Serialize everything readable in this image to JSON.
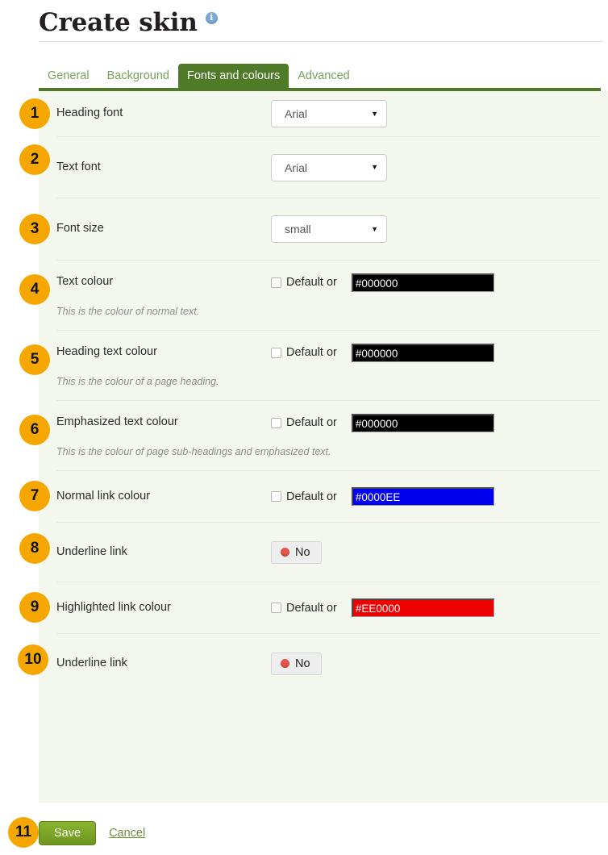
{
  "header": {
    "title": "Create skin",
    "info_icon": "info-icon"
  },
  "tabs": [
    {
      "label": "General",
      "active": false
    },
    {
      "label": "Background",
      "active": false
    },
    {
      "label": "Fonts and colours",
      "active": true
    },
    {
      "label": "Advanced",
      "active": false
    }
  ],
  "colors": {
    "accent_green": "#4f7a28",
    "tab_text_green": "#7ba05b",
    "badge_orange": "#f5a700",
    "panel_bg": "#f4f7ee",
    "save_green": "#7ba428",
    "info_blue": "#7da7d9",
    "toggle_dot_red": "#e8544b"
  },
  "rows": [
    {
      "badge": "1",
      "label": "Heading font",
      "control": "select",
      "value": "Arial",
      "help": ""
    },
    {
      "badge": "2",
      "label": "Text font",
      "control": "select",
      "value": "Arial",
      "help": ""
    },
    {
      "badge": "3",
      "label": "Font size",
      "control": "select",
      "value": "small",
      "help": ""
    },
    {
      "badge": "4",
      "label": "Text colour",
      "control": "colour",
      "checkbox_label": "Default or",
      "checked": false,
      "value": "#000000",
      "swatch": "#000000",
      "help": "This is the colour of normal text."
    },
    {
      "badge": "5",
      "label": "Heading text colour",
      "control": "colour",
      "checkbox_label": "Default or",
      "checked": false,
      "value": "#000000",
      "swatch": "#000000",
      "help": "This is the colour of a page heading."
    },
    {
      "badge": "6",
      "label": "Emphasized text colour",
      "control": "colour",
      "checkbox_label": "Default or",
      "checked": false,
      "value": "#000000",
      "swatch": "#000000",
      "help": "This is the colour of page sub-headings and emphasized text."
    },
    {
      "badge": "7",
      "label": "Normal link colour",
      "control": "colour",
      "checkbox_label": "Default or",
      "checked": false,
      "value": "#0000EE",
      "swatch": "#0000EE",
      "help": ""
    },
    {
      "badge": "8",
      "label": "Underline link",
      "control": "toggle",
      "value": "No",
      "help": ""
    },
    {
      "badge": "9",
      "label": "Highlighted link colour",
      "control": "colour",
      "checkbox_label": "Default or",
      "checked": false,
      "value": "#EE0000",
      "swatch": "#EE0000",
      "help": ""
    },
    {
      "badge": "10",
      "label": "Underline link",
      "control": "toggle",
      "value": "No",
      "help": ""
    }
  ],
  "footer": {
    "badge": "11",
    "save_label": "Save",
    "cancel_label": "Cancel"
  }
}
